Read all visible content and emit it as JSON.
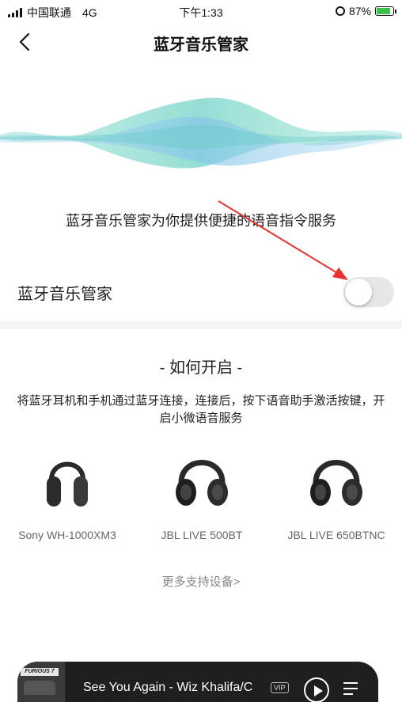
{
  "status_bar": {
    "carrier": "中国联通",
    "network": "4G",
    "time": "下午1:33",
    "battery": "87%"
  },
  "nav": {
    "title": "蓝牙音乐管家"
  },
  "intro": {
    "text": "蓝牙音乐管家为你提供便捷的语音指令服务"
  },
  "toggle": {
    "label": "蓝牙音乐管家",
    "enabled": false
  },
  "howto": {
    "title": "- 如何开启 -",
    "description": "将蓝牙耳机和手机通过蓝牙连接，连接后，按下语音助手激活按键，开启小微语音服务"
  },
  "devices": [
    {
      "name": "Sony WH-1000XM3"
    },
    {
      "name": "JBL LIVE 500BT"
    },
    {
      "name": "JBL LIVE 650BTNC"
    }
  ],
  "more_link": "更多支持设备>",
  "player": {
    "song": "See You Again - Wiz Khalifa/C",
    "badge": "VIP",
    "album_text": "FURIOUS 7"
  },
  "colors": {
    "wave_light": "#bfeae6",
    "wave_mid": "#86d8cf",
    "wave_deep": "#7fc6ea",
    "toggle_off": "#e6e6e6",
    "player_bg": "#1f1f1f",
    "arrow": "#e8332f"
  }
}
